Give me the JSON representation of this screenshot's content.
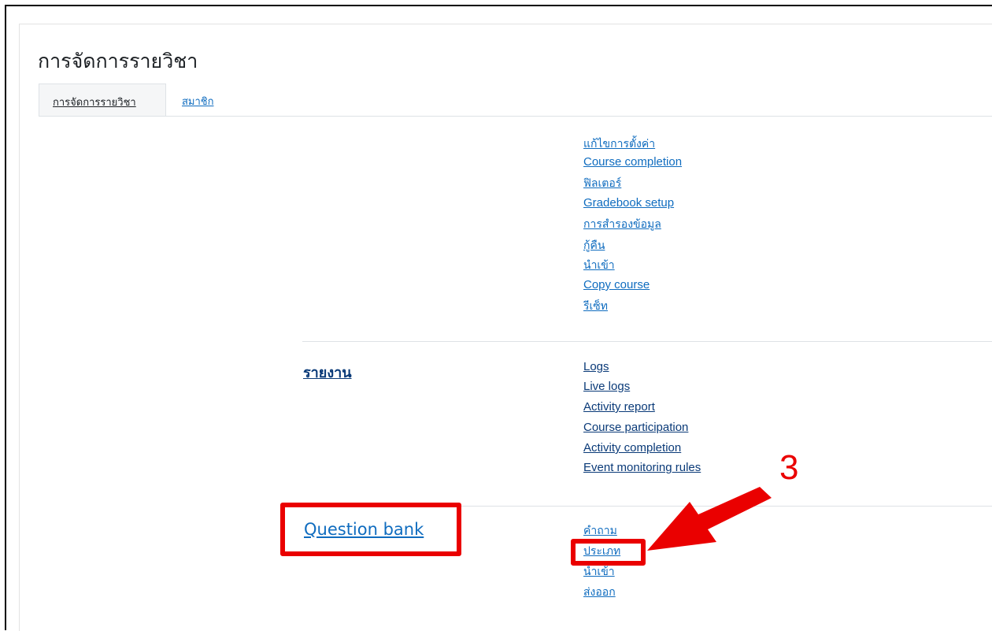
{
  "page_title": "การจัดการรายวิชา",
  "tabs": {
    "manage": "การจัดการรายวิชา",
    "members": "สมาชิก"
  },
  "course_admin_links": [
    "แก้ไขการตั้งค่า",
    "Course completion",
    "ฟิลเตอร์",
    "Gradebook setup",
    "การสำรองข้อมูล",
    "กู้คืน",
    "นำเข้า",
    "Copy course",
    "รีเซ็ท"
  ],
  "reports": {
    "heading": "รายงาน",
    "links": [
      "Logs",
      "Live logs",
      "Activity report",
      "Course participation",
      "Activity completion",
      "Event monitoring rules"
    ]
  },
  "question_bank": {
    "heading": "Question bank",
    "links": [
      "คำถาม",
      "ประเภท",
      "นำเข้า",
      "ส่งออก"
    ]
  },
  "annotation": {
    "step_number": "3",
    "color": "#ea0000"
  }
}
